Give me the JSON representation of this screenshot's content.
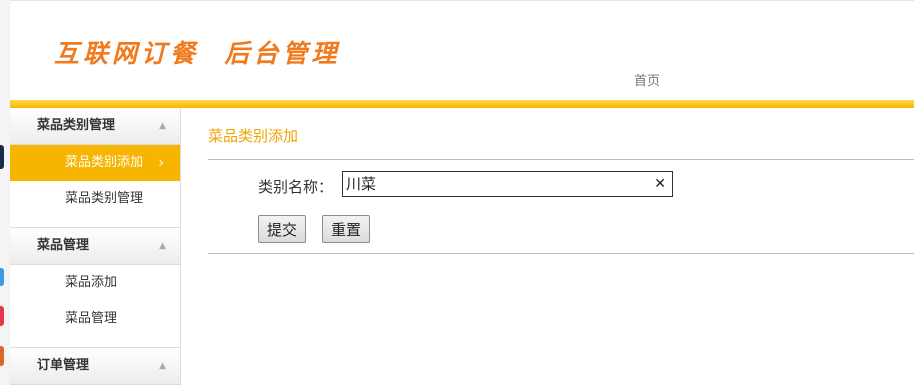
{
  "header": {
    "logo_text": "互联网订餐  后台管理",
    "nav_home": "首页",
    "accent_color": "#f7b400",
    "logo_color": "#f07a1d"
  },
  "sidebar": {
    "groups": [
      {
        "title": "菜品类别管理",
        "items": [
          {
            "label": "菜品类别添加",
            "active": true
          },
          {
            "label": "菜品类别管理",
            "active": false
          }
        ]
      },
      {
        "title": "菜品管理",
        "items": [
          {
            "label": "菜品添加",
            "active": false
          },
          {
            "label": "菜品管理",
            "active": false
          }
        ]
      },
      {
        "title": "订单管理",
        "items": []
      }
    ],
    "caret_icon": "triangle-up-icon",
    "active_chevron_icon": "chevron-right-icon"
  },
  "main": {
    "page_title": "菜品类别添加",
    "form": {
      "category_label": "类别名称：",
      "category_value": "川菜",
      "clear_icon": "close-icon",
      "submit_label": "提交",
      "reset_label": "重置"
    }
  }
}
